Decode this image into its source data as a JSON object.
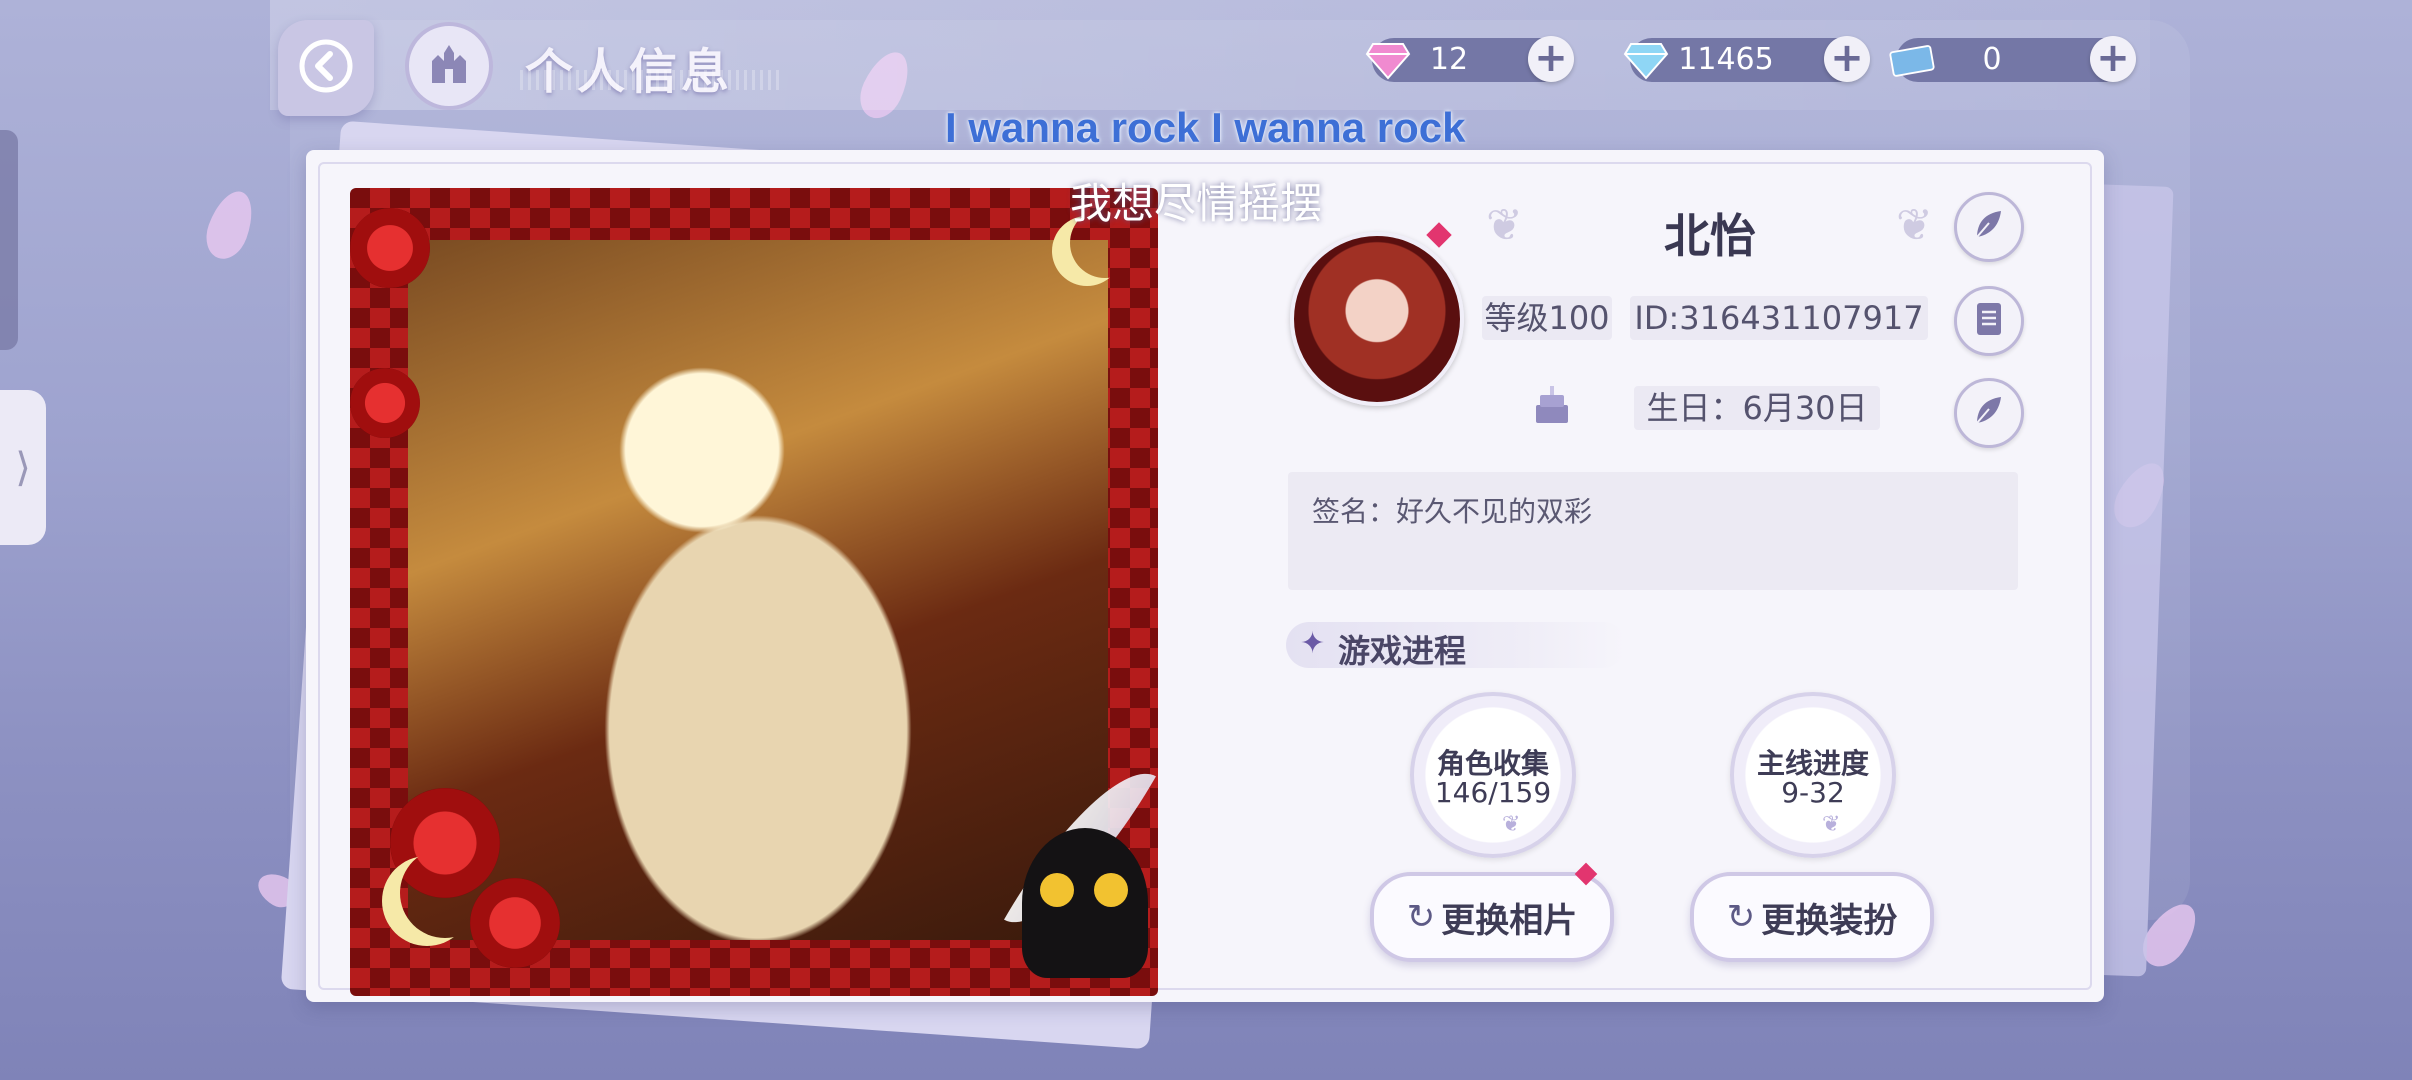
{
  "header": {
    "title": "个人信息",
    "back_icon": "back-arrow-icon",
    "home_icon": "castle-home-icon"
  },
  "currencies": [
    {
      "name": "premium-gem",
      "icon": "pink-diamond-icon",
      "value": "12"
    },
    {
      "name": "diamond",
      "icon": "blue-diamond-icon",
      "value": "11465"
    },
    {
      "name": "ticket",
      "icon": "ticket-icon",
      "value": "0"
    }
  ],
  "lyrics": {
    "english": "I wanna rock I wanna rock",
    "chinese": "我想尽情摇摆"
  },
  "profile": {
    "name": "北怡",
    "level": "等级100",
    "id": "ID:316431107917",
    "birthday": "生日：6月30日",
    "signature": "签名：好久不见的双彩"
  },
  "progress": {
    "section_title": "游戏进程",
    "stats": [
      {
        "label": "角色收集",
        "value": "146/159"
      },
      {
        "label": "主线进度",
        "value": "9-32"
      }
    ]
  },
  "actions": {
    "change_photo": "更换相片",
    "change_outfit": "更换装扮"
  },
  "colors": {
    "background": "#9ea3cf",
    "panel": "#f6f5fb",
    "accent": "#6b5aa6",
    "notification": "#e2356f",
    "lyric_english": "#3d6fd6"
  }
}
